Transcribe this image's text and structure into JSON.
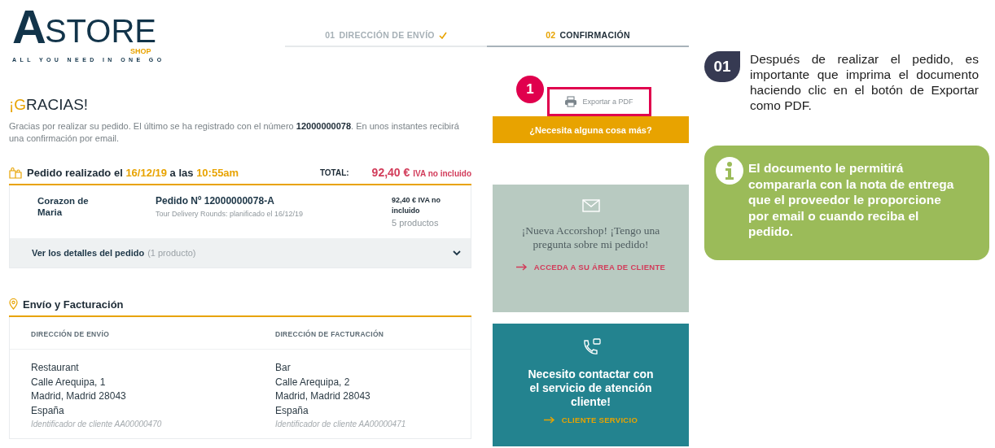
{
  "logo": {
    "mark": "A",
    "name": "STORE",
    "sub": "SHOP",
    "tagline": "ALL YOU NEED IN ONE GO"
  },
  "steps": [
    {
      "number": "01",
      "label": "DIRECCIÓN DE ENVÍO",
      "completed": true,
      "selected": false
    },
    {
      "number": "02",
      "label": "CONFIRMACIÓN",
      "completed": false,
      "selected": true
    }
  ],
  "thanks": {
    "title": [
      {
        "text": "¡G",
        "accent": true
      },
      {
        "text": "RACIAS!",
        "accent": false
      }
    ],
    "message": "Gracias por realizar su pedido. El último se ha registrado con el número **12000000078**. En unos instantes recibirá una confirmación por email."
  },
  "order": {
    "heading": [
      {
        "text": "Pedido realizado el ",
        "accent": false
      },
      {
        "text": "16/12/19",
        "accent": true
      },
      {
        "text": " a las ",
        "accent": false
      },
      {
        "text": "10:55am",
        "accent": true
      }
    ],
    "total_label": "TOTAL:",
    "total_amount": "92,40 €",
    "total_note": "IVA no incluido",
    "customer": "Corazon de Maria",
    "order_number": "Pedido Nº 12000000078-A",
    "delivery": "Tour Delivery Rounds: planificado el 16/12/19",
    "price": "92,40 €",
    "price_note": "IVA no incluido",
    "products": "5 productos",
    "details": {
      "label": "Ver los detalles del pedido",
      "count": "(1 producto)",
      "expanded": false
    }
  },
  "addresses": {
    "title": "Envío y Facturación",
    "columns": [
      {
        "heading": "DIRECCIÓN DE ENVÍO",
        "lines": [
          "Restaurant",
          "Calle Arequipa, 1",
          "Madrid, Madrid 28043",
          "España"
        ],
        "client_id": "Identificador de cliente AA00000470"
      },
      {
        "heading": "DIRECCIÓN DE FACTURACIÓN",
        "lines": [
          "Bar",
          "Calle Arequipa, 2",
          "Madrid, Madrid 28043",
          "España"
        ],
        "client_id": "Identificador de cliente AA00000471"
      }
    ]
  },
  "export": {
    "label": "Exportar a PDF",
    "callout": "1"
  },
  "help_button": "¿Necesita alguna cosa más?",
  "cards": [
    {
      "kind": "mail",
      "text": "¡Nueva Accorshop! ¡Tengo una pregunta sobre mi pedido!",
      "link": "ACCEDA A SU ÁREA DE CLIENTE"
    },
    {
      "kind": "phone",
      "text": "Necesito contactar con el servicio de atención cliente!",
      "link": "CLIENTE SERVICIO"
    }
  ],
  "annotation": {
    "step": "01",
    "text": "Después de realizar el pedido, es importante que imprima el documento haciendo clic en el botón de Exportar como PDF.",
    "note": "El documento le permitirá compararla con la nota de entrega que el proveedor le proporcione por email o cuando reciba el pedido."
  }
}
